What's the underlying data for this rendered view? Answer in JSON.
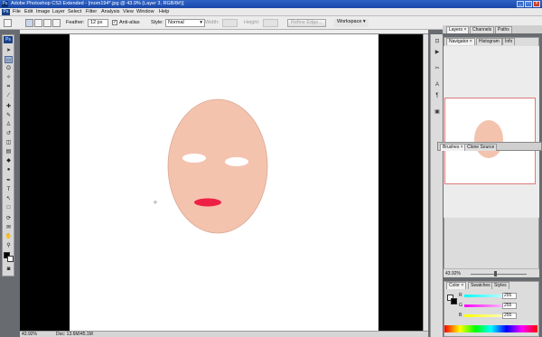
{
  "window": {
    "title": "Adobe Photoshop CS3 Extended - [mom194*.jpg @ 43.9% (Layer 3, RGB/8#)]",
    "app_icon": "Ps"
  },
  "menu": [
    "File",
    "Edit",
    "Image",
    "Layer",
    "Select",
    "Filter",
    "Analysis",
    "View",
    "Window",
    "Help"
  ],
  "options_bar": {
    "feather_label": "Feather:",
    "feather_value": "12 px",
    "antialias_label": "Anti-alias",
    "style_label": "Style:",
    "style_value": "Normal",
    "width_label": "Width:",
    "height_label": "Height:",
    "refine_edge": "Refine Edge...",
    "workspace": "Workspace ▾"
  },
  "tools": {
    "badge": "Ps",
    "foreground_color": "#000000",
    "background_color": "#ffffff"
  },
  "panels": {
    "top_tabs": [
      "Layers ×",
      "Channels",
      "Paths"
    ],
    "navigator_tabs": [
      "Navigator ×",
      "Histogram",
      "Info"
    ],
    "navigator_zoom": "43.92%",
    "floating_tabs": [
      "Brushes ×",
      "Clone Source"
    ],
    "color_tabs": [
      "Color ×",
      "Swatches",
      "Styles"
    ],
    "color_sliders": [
      {
        "letter": "R",
        "value": "255"
      },
      {
        "letter": "G",
        "value": "255"
      },
      {
        "letter": "B",
        "value": "255"
      }
    ]
  },
  "status": {
    "zoom": "43.92%",
    "doc": "Doc: 13.6M/45.1M"
  },
  "artwork": {
    "face_color": "#f4c3ae",
    "eye_color": "#ffffff",
    "lips_color": "#ee2145"
  }
}
